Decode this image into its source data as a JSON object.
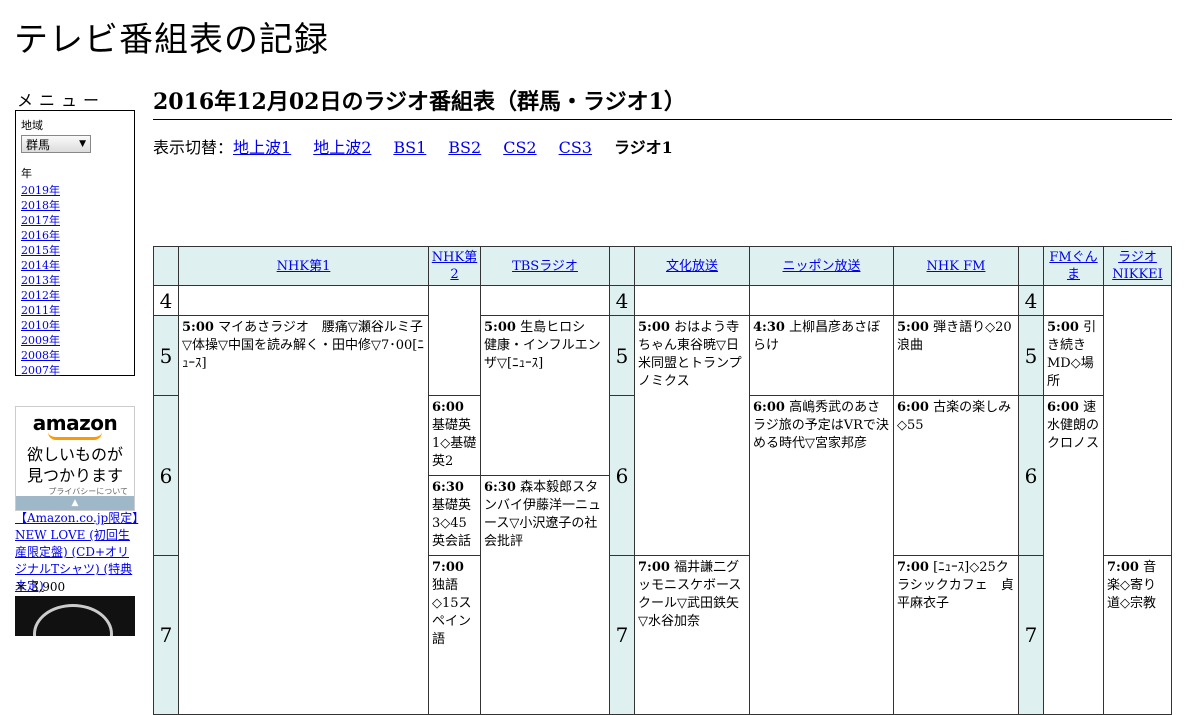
{
  "site": {
    "title": "テレビ番組表の記録"
  },
  "menu": {
    "heading": "メニュー",
    "region_label": "地域",
    "region_value": "群馬",
    "year_label": "年",
    "years": [
      "2019年",
      "2018年",
      "2017年",
      "2016年",
      "2015年",
      "2014年",
      "2013年",
      "2012年",
      "2011年",
      "2010年",
      "2009年",
      "2008年",
      "2007年"
    ]
  },
  "ad": {
    "logo": "amazon",
    "tagline1": "欲しいものが",
    "tagline2": "見つかります",
    "privacy": "プライバシーについて",
    "product": "【Amazon.co.jp限定】NEW LOVE (初回生産限定盤) (CD+オリジナルTシャツ) (特典未定)",
    "price": "￥ 3,900"
  },
  "page": {
    "title": "2016年12月02日のラジオ番組表（群馬・ラジオ1）",
    "switch_label": "表示切替：",
    "tabs": [
      {
        "label": "地上波1",
        "current": false
      },
      {
        "label": "地上波2",
        "current": false
      },
      {
        "label": "BS1",
        "current": false
      },
      {
        "label": "BS2",
        "current": false
      },
      {
        "label": "CS2",
        "current": false
      },
      {
        "label": "CS3",
        "current": false
      },
      {
        "label": "ラジオ1",
        "current": true
      }
    ]
  },
  "stations": {
    "nhk1": "NHK第1",
    "nhk2": "NHK第2",
    "tbs": "TBSラジオ",
    "bunka": "文化放送",
    "nippon": "ニッポン放送",
    "nhkfm": "NHK FM",
    "fmgunma": "FMぐんま",
    "nikkei": "ラジオNIKKEI"
  },
  "hours": {
    "h4": "4",
    "h5": "5",
    "h6": "6",
    "h7": "7"
  },
  "programs": {
    "nhk1_500": {
      "time": "5:00",
      "title": "マイあさラジオ　腰痛▽瀬谷ルミ子▽体操▽中国を読み解く・田中修▽7･00[ﾆｭｰｽ]"
    },
    "tbs_500": {
      "time": "5:00",
      "title": "生島ヒロシ　健康・インフルエンザ▽[ﾆｭｰｽ]"
    },
    "tbs_630": {
      "time": "6:30",
      "title": "森本毅郎スタンバイ伊藤洋一ニュース▽小沢遼子の社会批評"
    },
    "nhk2_600": {
      "time": "6:00",
      "title": "基礎英1◇基礎英2"
    },
    "nhk2_630": {
      "time": "6:30",
      "title": "基礎英3◇45英会話"
    },
    "nhk2_700": {
      "time": "7:00",
      "title": "独語◇15スペイン語"
    },
    "bunka_500": {
      "time": "5:00",
      "title": "おはよう寺ちゃん東谷暁▽日米同盟とトランプノミクス"
    },
    "bunka_700": {
      "time": "7:00",
      "title": "福井謙二グッモニスケボースクール▽武田鉄矢▽水谷加奈"
    },
    "nippon_430": {
      "time": "4:30",
      "title": "上柳昌彦あさぼらけ"
    },
    "nippon_600": {
      "time": "6:00",
      "title": "高嶋秀武のあさラジ旅の予定はVRで決める時代▽宮家邦彦"
    },
    "fm_500": {
      "time": "5:00",
      "title": "弾き語り◇20浪曲"
    },
    "fm_600": {
      "time": "6:00",
      "title": "古楽の楽しみ◇55"
    },
    "fm_700": {
      "time": "7:00",
      "title": "[ﾆｭｰｽ]◇25クラシックカフェ　貞平麻衣子"
    },
    "gunma_500": {
      "time": "5:00",
      "title": "引き続きMD◇場所"
    },
    "gunma_600": {
      "time": "6:00",
      "title": "速水健朗のクロノス"
    },
    "nikkei_700": {
      "time": "7:00",
      "title": "音楽◇寄り道◇宗教"
    }
  }
}
